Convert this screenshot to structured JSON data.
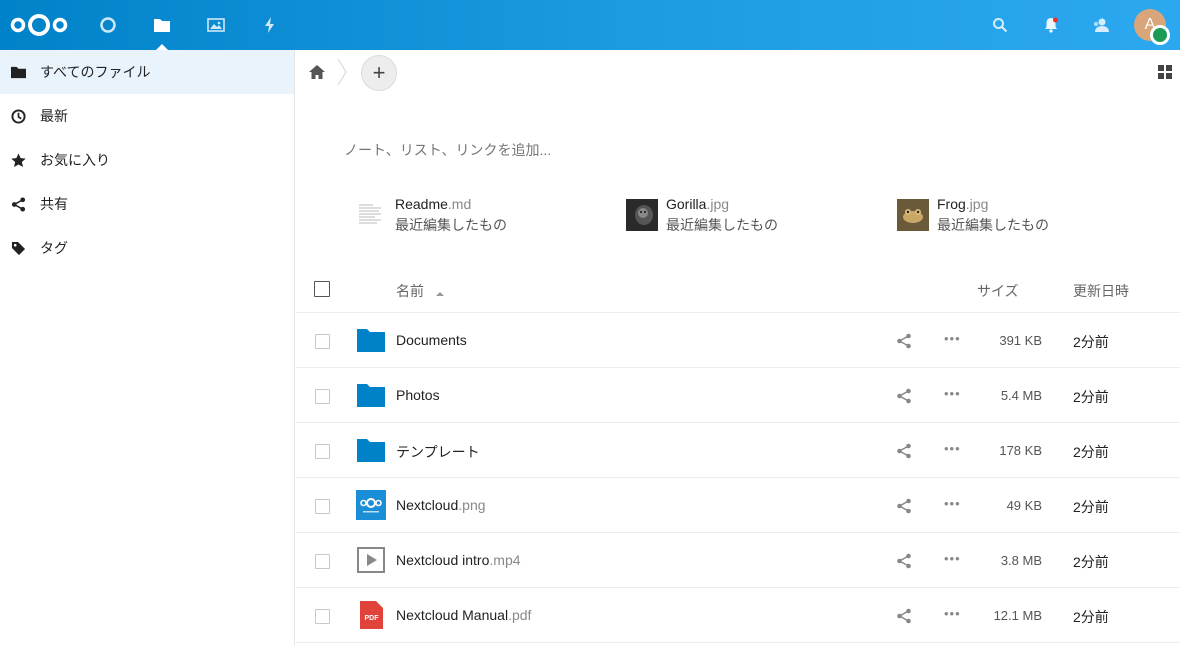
{
  "header": {
    "apps": [
      {
        "name": "dashboard-icon"
      },
      {
        "name": "files-icon"
      },
      {
        "name": "photos-icon"
      },
      {
        "name": "activity-icon"
      }
    ],
    "right": [
      "search-icon",
      "notifications-icon",
      "contacts-icon"
    ],
    "avatar_letter": "A",
    "accent": "#0082c9"
  },
  "sidebar": {
    "items": [
      {
        "label": "すべてのファイル",
        "icon": "folder-icon"
      },
      {
        "label": "最新",
        "icon": "clock-icon"
      },
      {
        "label": "お気に入り",
        "icon": "star-icon"
      },
      {
        "label": "共有",
        "icon": "share-icon"
      },
      {
        "label": "タグ",
        "icon": "tag-icon"
      }
    ]
  },
  "breadcrumb": {
    "add_label": "+"
  },
  "notes": {
    "placeholder": "ノート、リスト、リンクを追加..."
  },
  "recent": [
    {
      "base": "Readme",
      "ext": ".md",
      "sub": "最近編集したもの"
    },
    {
      "base": "Gorilla",
      "ext": ".jpg",
      "sub": "最近編集したもの"
    },
    {
      "base": "Frog",
      "ext": ".jpg",
      "sub": "最近編集したもの"
    }
  ],
  "table": {
    "headers": {
      "name": "名前",
      "size": "サイズ",
      "modified": "更新日時"
    },
    "rows": [
      {
        "base": "Documents",
        "ext": "",
        "type": "folder",
        "size": "391 KB",
        "date": "2分前"
      },
      {
        "base": "Photos",
        "ext": "",
        "type": "folder",
        "size": "5.4 MB",
        "date": "2分前"
      },
      {
        "base": "テンプレート",
        "ext": "",
        "type": "folder",
        "size": "178 KB",
        "date": "2分前"
      },
      {
        "base": "Nextcloud",
        "ext": ".png",
        "type": "image",
        "size": "49 KB",
        "date": "2分前"
      },
      {
        "base": "Nextcloud intro",
        "ext": ".mp4",
        "type": "video",
        "size": "3.8 MB",
        "date": "2分前"
      },
      {
        "base": "Nextcloud Manual",
        "ext": ".pdf",
        "type": "pdf",
        "size": "12.1 MB",
        "date": "2分前"
      }
    ]
  }
}
